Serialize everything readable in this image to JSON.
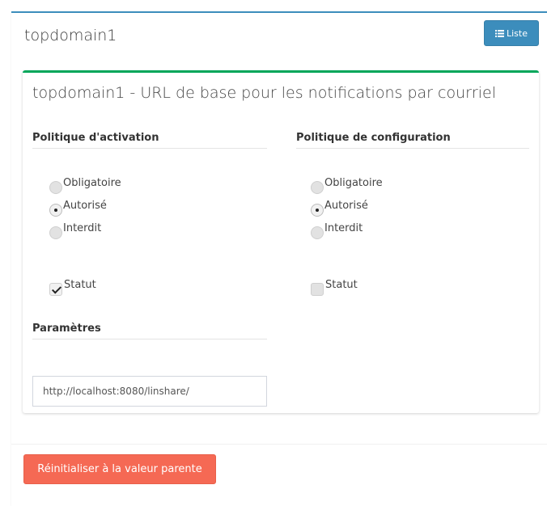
{
  "header": {
    "title": "topdomain1",
    "list_button": {
      "label": "Liste",
      "icon": "list-icon"
    }
  },
  "panel": {
    "title": "topdomain1 - URL de base pour les notifications par courriel",
    "activation": {
      "heading": "Politique d'activation",
      "options": [
        "Obligatoire",
        "Autorisé",
        "Interdit"
      ],
      "selected": "Autorisé",
      "status_label": "Statut",
      "status_checked": true
    },
    "configuration": {
      "heading": "Politique de configuration",
      "options": [
        "Obligatoire",
        "Autorisé",
        "Interdit"
      ],
      "selected": "Autorisé",
      "status_label": "Statut",
      "status_checked": false
    },
    "parameters": {
      "heading": "Paramètres",
      "url_value": "http://localhost:8080/linshare/"
    }
  },
  "footer": {
    "reset_button": "Réinitialiser à la valeur parente"
  },
  "colors": {
    "header_border": "#3c8dbc",
    "panel_border": "#00a65a",
    "primary_button": "#3c8dbc",
    "danger_button": "#f56954"
  }
}
